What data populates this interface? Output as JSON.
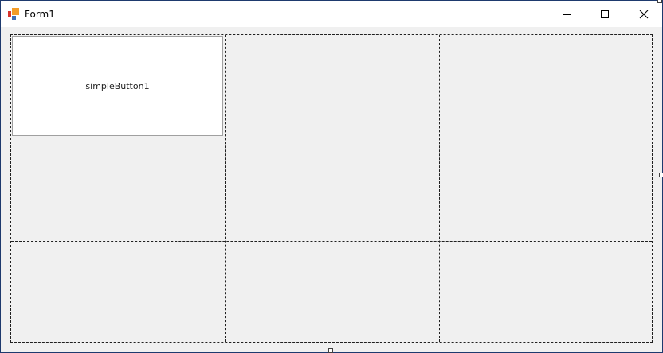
{
  "window": {
    "title": "Form1",
    "icon": "devexpress-form-icon",
    "accent_border": "#1e3a6e"
  },
  "caption_buttons": {
    "minimize": "minimize-icon",
    "maximize": "maximize-icon",
    "close": "close-icon"
  },
  "layout_panel": {
    "rows": 3,
    "columns": 3,
    "border_style": "dashed"
  },
  "simple_button": {
    "label": "simpleButton1"
  }
}
